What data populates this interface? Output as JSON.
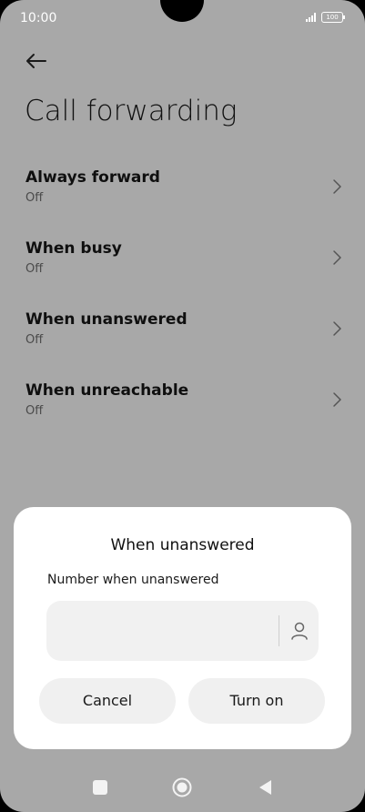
{
  "status_bar": {
    "time": "10:00",
    "battery": "100"
  },
  "header": {
    "title": "Call forwarding"
  },
  "list": {
    "items": [
      {
        "title": "Always forward",
        "status": "Off"
      },
      {
        "title": "When busy",
        "status": "Off"
      },
      {
        "title": "When unanswered",
        "status": "Off"
      },
      {
        "title": "When unreachable",
        "status": "Off"
      }
    ]
  },
  "dialog": {
    "title": "When unanswered",
    "field_label": "Number when unanswered",
    "field_value": "",
    "field_placeholder": "",
    "cancel_label": "Cancel",
    "confirm_label": "Turn on"
  },
  "icons": {
    "back": "arrow-left-icon",
    "chevron": "chevron-right-icon",
    "contact": "person-icon",
    "nav_recents": "square-icon",
    "nav_home": "circle-icon",
    "nav_back": "triangle-icon"
  },
  "colors": {
    "background_dimmed": "#a8a8a8",
    "dialog_background": "#ffffff",
    "button_background": "#f0f0f0"
  }
}
